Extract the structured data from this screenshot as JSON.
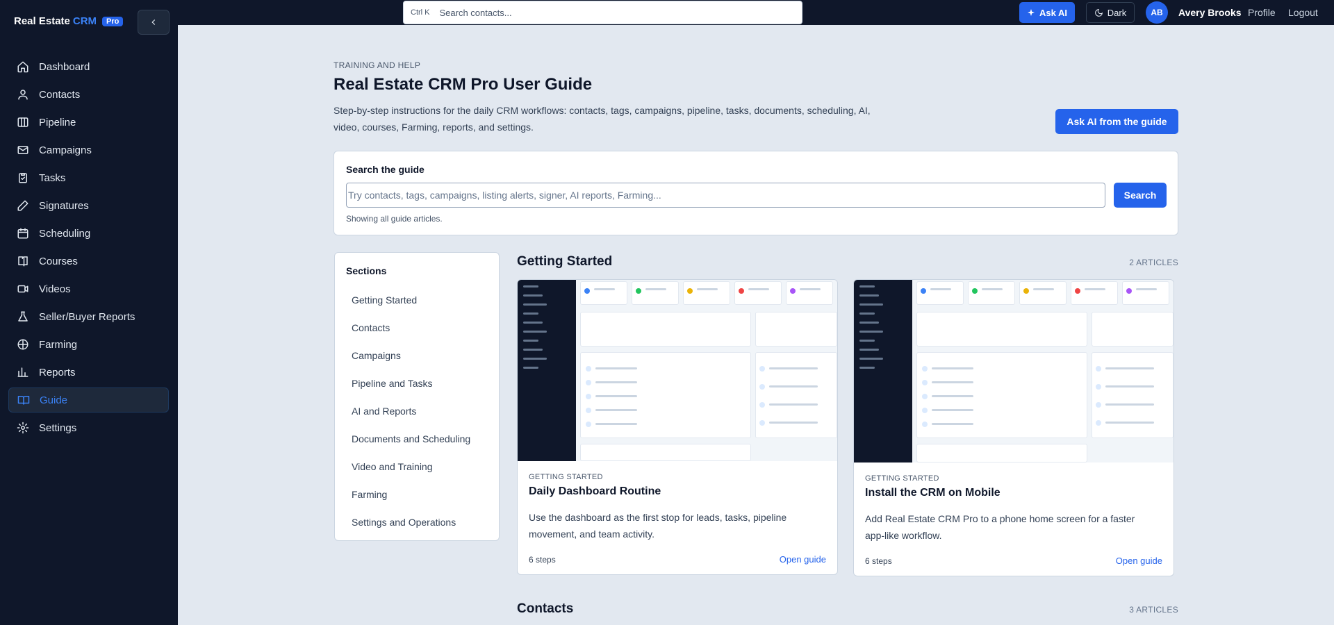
{
  "brand": {
    "name": "Real Estate",
    "crm": "CRM",
    "badge": "Pro"
  },
  "nav": [
    {
      "label": "Dashboard",
      "icon": "home-icon"
    },
    {
      "label": "Contacts",
      "icon": "contacts-icon"
    },
    {
      "label": "Pipeline",
      "icon": "pipeline-icon"
    },
    {
      "label": "Campaigns",
      "icon": "mail-icon"
    },
    {
      "label": "Tasks",
      "icon": "clipboard-check-icon"
    },
    {
      "label": "Signatures",
      "icon": "pen-icon"
    },
    {
      "label": "Scheduling",
      "icon": "calendar-icon"
    },
    {
      "label": "Courses",
      "icon": "book-icon"
    },
    {
      "label": "Videos",
      "icon": "video-icon"
    },
    {
      "label": "Seller/Buyer Reports",
      "icon": "flask-icon"
    },
    {
      "label": "Farming",
      "icon": "map-pin-circle-icon"
    },
    {
      "label": "Reports",
      "icon": "bar-chart-icon"
    },
    {
      "label": "Guide",
      "icon": "book-open-icon",
      "active": true
    },
    {
      "label": "Settings",
      "icon": "gear-icon"
    }
  ],
  "topbar": {
    "shortcut": "Ctrl K",
    "search_placeholder": "Search contacts...",
    "ask_ai": "Ask AI",
    "dark": "Dark",
    "avatar_initials": "AB",
    "user_name": "Avery Brooks",
    "profile": "Profile",
    "logout": "Logout"
  },
  "header": {
    "eyebrow": "TRAINING AND HELP",
    "title": "Real Estate CRM Pro User Guide",
    "description": "Step-by-step instructions for the daily CRM workflows: contacts, tags, campaigns, pipeline, tasks, documents, scheduling, AI, video, courses, Farming, reports, and settings.",
    "ask_button": "Ask AI from the guide"
  },
  "search": {
    "label": "Search the guide",
    "placeholder": "Try contacts, tags, campaigns, listing alerts, signer, AI reports, Farming...",
    "button": "Search",
    "status": "Showing all guide articles."
  },
  "sections": {
    "title": "Sections",
    "items": [
      "Getting Started",
      "Contacts",
      "Campaigns",
      "Pipeline and Tasks",
      "AI and Reports",
      "Documents and Scheduling",
      "Video and Training",
      "Farming",
      "Settings and Operations"
    ]
  },
  "groups": [
    {
      "title": "Getting Started",
      "count": "2 ARTICLES"
    },
    {
      "title": "Contacts",
      "count": "3 ARTICLES"
    }
  ],
  "articles": [
    {
      "category": "GETTING STARTED",
      "title": "Daily Dashboard Routine",
      "description": "Use the dashboard as the first stop for leads, tasks, pipeline movement, and team activity.",
      "steps": "6 steps",
      "link": "Open guide"
    },
    {
      "category": "GETTING STARTED",
      "title": "Install the CRM on Mobile",
      "description": "Add Real Estate CRM Pro to a phone home screen for a faster app-like workflow.",
      "steps": "6 steps",
      "link": "Open guide"
    }
  ],
  "colors": {
    "sidebar": "#0f172a",
    "accent": "#2563eb",
    "page_bg": "#e2e8f0"
  }
}
